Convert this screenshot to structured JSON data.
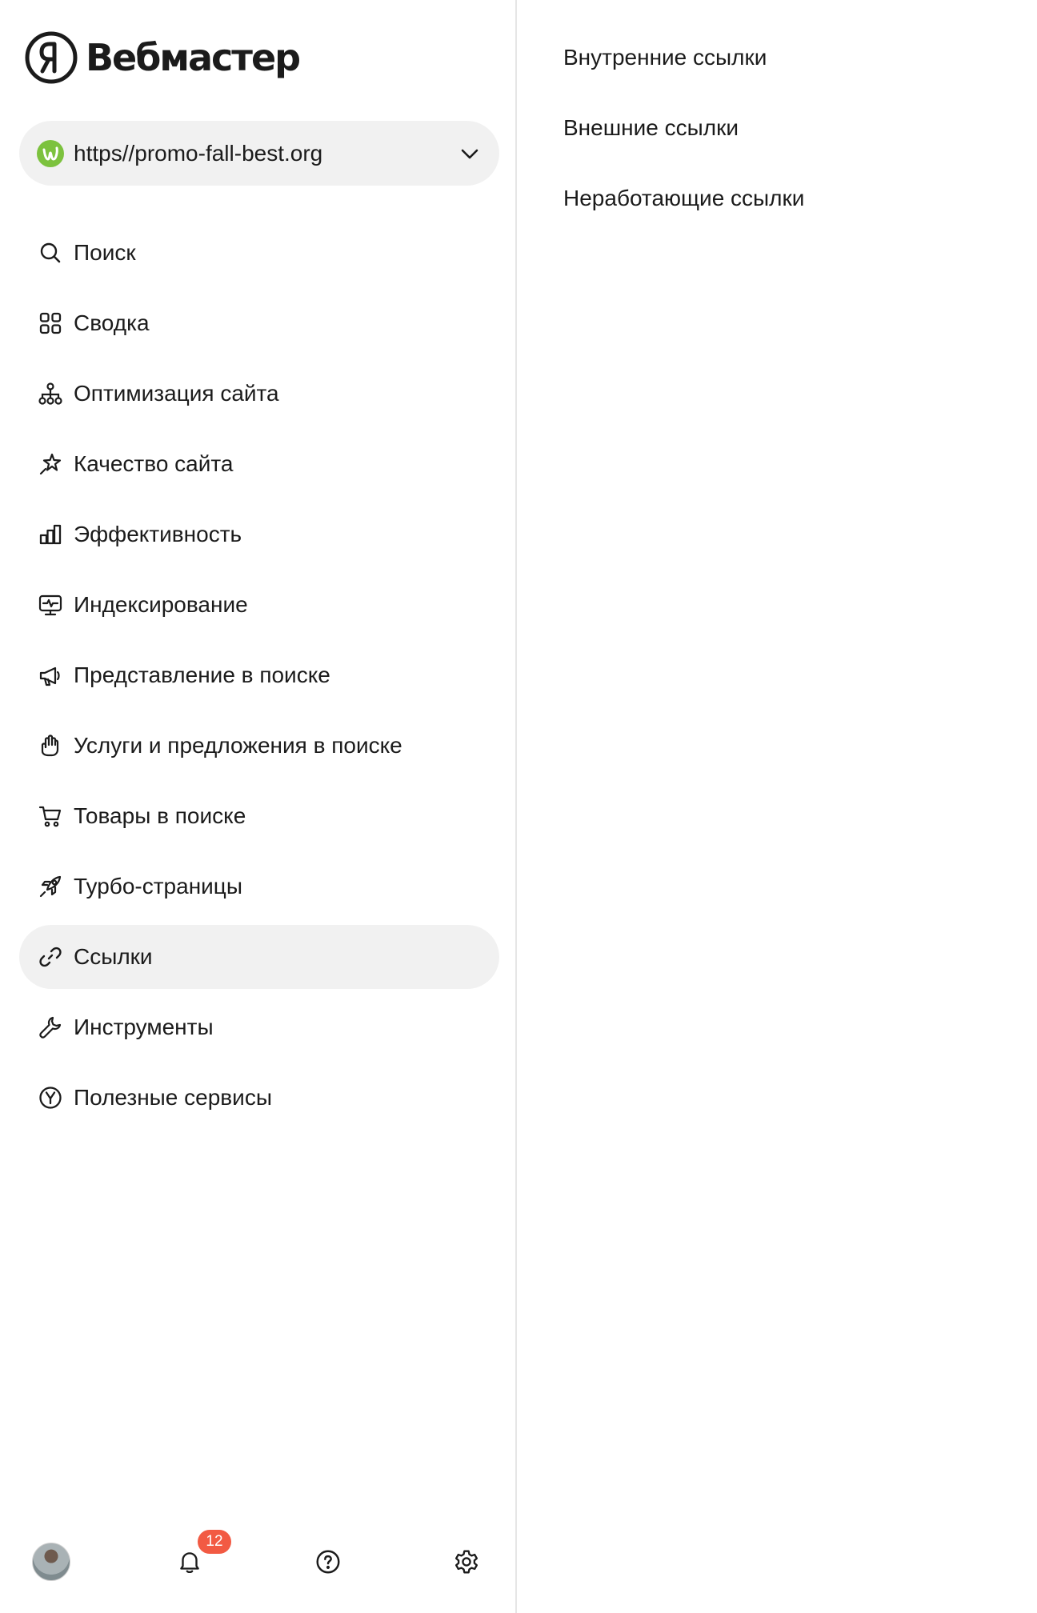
{
  "app": {
    "logo_text": "Вебмастер"
  },
  "site_selector": {
    "url": "https//promo-fall-best.org",
    "favicon_color": "#7cc23e"
  },
  "nav": {
    "items": [
      {
        "label": "Поиск",
        "icon": "search-icon"
      },
      {
        "label": "Сводка",
        "icon": "grid-icon"
      },
      {
        "label": "Оптимизация сайта",
        "icon": "sitemap-icon"
      },
      {
        "label": "Качество сайта",
        "icon": "sparkle-star-icon"
      },
      {
        "label": "Эффективность",
        "icon": "bar-chart-icon"
      },
      {
        "label": "Индексирование",
        "icon": "monitor-pulse-icon"
      },
      {
        "label": "Представление в поиске",
        "icon": "megaphone-icon"
      },
      {
        "label": "Услуги и предложения в поиске",
        "icon": "hand-service-icon"
      },
      {
        "label": "Товары в поиске",
        "icon": "cart-icon"
      },
      {
        "label": "Турбо-страницы",
        "icon": "rocket-icon"
      },
      {
        "label": "Ссылки",
        "icon": "link-icon",
        "active": true
      },
      {
        "label": "Инструменты",
        "icon": "wrench-icon"
      },
      {
        "label": "Полезные сервисы",
        "icon": "yandex-circle-icon"
      }
    ]
  },
  "footer": {
    "notifications_count": "12",
    "badge_color": "#f25a43"
  },
  "links_submenu": {
    "items": [
      "Внутренние ссылки",
      "Внешние ссылки",
      "Неработающие ссылки"
    ]
  },
  "colors": {
    "active_bg": "#f1f1f1",
    "text": "#1b1b1b",
    "divider": "#e6e6e6"
  }
}
